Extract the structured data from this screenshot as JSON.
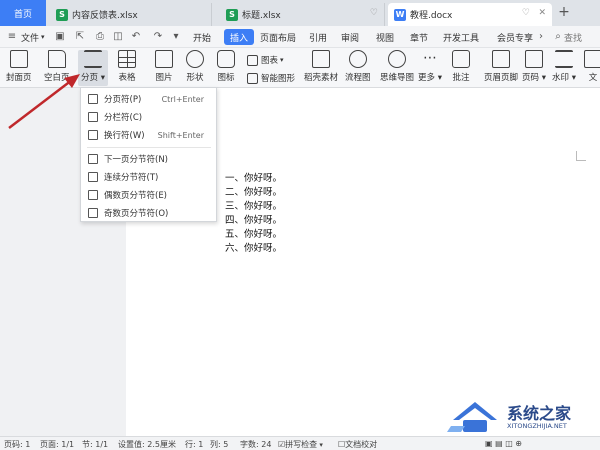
{
  "tabs": {
    "home": "首页",
    "tab1": "内容反馈表.xlsx",
    "tab2": "标题.xlsx",
    "tab3": "教程.docx"
  },
  "menu": {
    "file": "文件",
    "items": [
      "开始",
      "插入",
      "页面布局",
      "引用",
      "审阅",
      "视图",
      "章节",
      "开发工具",
      "会员专享"
    ],
    "search_placeholder": "查找"
  },
  "ribbon": {
    "buttons": [
      "封面页",
      "空白页",
      "分页",
      "表格",
      "图片",
      "形状",
      "图标",
      "稻壳素材",
      "流程图",
      "思维导图",
      "更多",
      "批注",
      "页眉页脚",
      "页码",
      "水印",
      "文"
    ],
    "small": [
      "图表",
      "智能图形"
    ]
  },
  "dropdown": {
    "items": [
      {
        "label": "分页符(P)",
        "key": "Ctrl+Enter"
      },
      {
        "label": "分栏符(C)",
        "key": ""
      },
      {
        "label": "换行符(W)",
        "key": "Shift+Enter"
      },
      {
        "label": "下一页分节符(N)",
        "key": ""
      },
      {
        "label": "连续分节符(T)",
        "key": ""
      },
      {
        "label": "偶数页分节符(E)",
        "key": ""
      },
      {
        "label": "奇数页分节符(O)",
        "key": ""
      }
    ]
  },
  "document": {
    "lines": [
      "一、你好呀。",
      "二、你好呀。",
      "三、你好呀。",
      "四、你好呀。",
      "五、你好呀。",
      "六、你好呀。"
    ]
  },
  "status": {
    "page_no": "页码: 1",
    "pages": "页面: 1/1",
    "section": "节: 1/1",
    "setting": "设置值: 2.5厘米",
    "row": "行: 1",
    "col": "列: 5",
    "words": "字数: 24",
    "spell": "拼写检查",
    "proof": "文档校对"
  },
  "watermark": {
    "title": "系统之家",
    "sub": "XITONGZHIJIA.NET"
  },
  "colors": {
    "accent": "#3d7ef5",
    "arrow": "#c0282b"
  }
}
